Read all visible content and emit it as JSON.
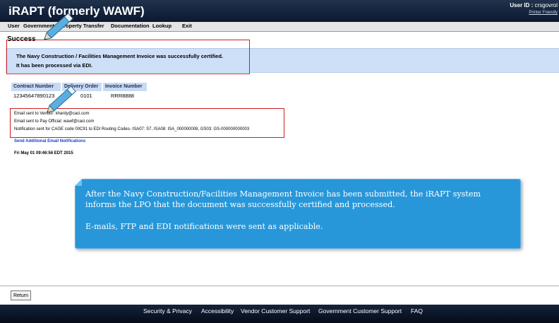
{
  "header": {
    "title": "iRAPT (formerly WAWF)",
    "user_id_label": "User ID :",
    "user_id_value": "crsgovrol",
    "printer_friendly": "Printer Friendly"
  },
  "menu": [
    {
      "label": "User"
    },
    {
      "label": "Government"
    },
    {
      "label": "Property Transfer"
    },
    {
      "label": "Documentation"
    },
    {
      "label": "Lookup"
    },
    {
      "label": "Exit"
    }
  ],
  "page": {
    "heading": "Success",
    "message_line1": "The Navy Construction / Facilities Management Invoice was successfully certified.",
    "message_line2": "It has been processed via EDI."
  },
  "document_table": {
    "headers": [
      "Contract Number",
      "Delivery Order",
      "Invoice Number"
    ],
    "row": [
      "12345647890123",
      "0101",
      "RRR8888"
    ]
  },
  "notifications": [
    "Email sent to Vendor: khardy@caci.com",
    "Email sent to Pay Official: wawf@caci.com",
    "Notification sent for CAGE code 00C91 to EDI Routing Codes- ISA07: S7, ISA08: ISA_000000008, GS03: GS-000000000003"
  ],
  "send_additional": "Send Additional Email Notifications",
  "timestamp": "Fri May 01 09:46:56 EDT 2015",
  "callout": {
    "paragraph1": "After the Navy Construction/Facilities Management Invoice has been submitted, the iRAPT system informs the LPO that the document was successfully certified and processed.",
    "paragraph2": "E-mails, FTP and EDI notifications were sent as applicable."
  },
  "return_button": "Return",
  "footer": {
    "links": [
      "Security & Privacy",
      "Accessibility",
      "Vendor Customer Support",
      "Government Customer Support",
      "FAQ"
    ]
  },
  "colors": {
    "header_bg": "#1a2a44",
    "success_bg": "#cde0f7",
    "highlight_border": "#cc1f1f",
    "callout_bg": "#2797d9",
    "link_blue": "#1e3fbf"
  }
}
